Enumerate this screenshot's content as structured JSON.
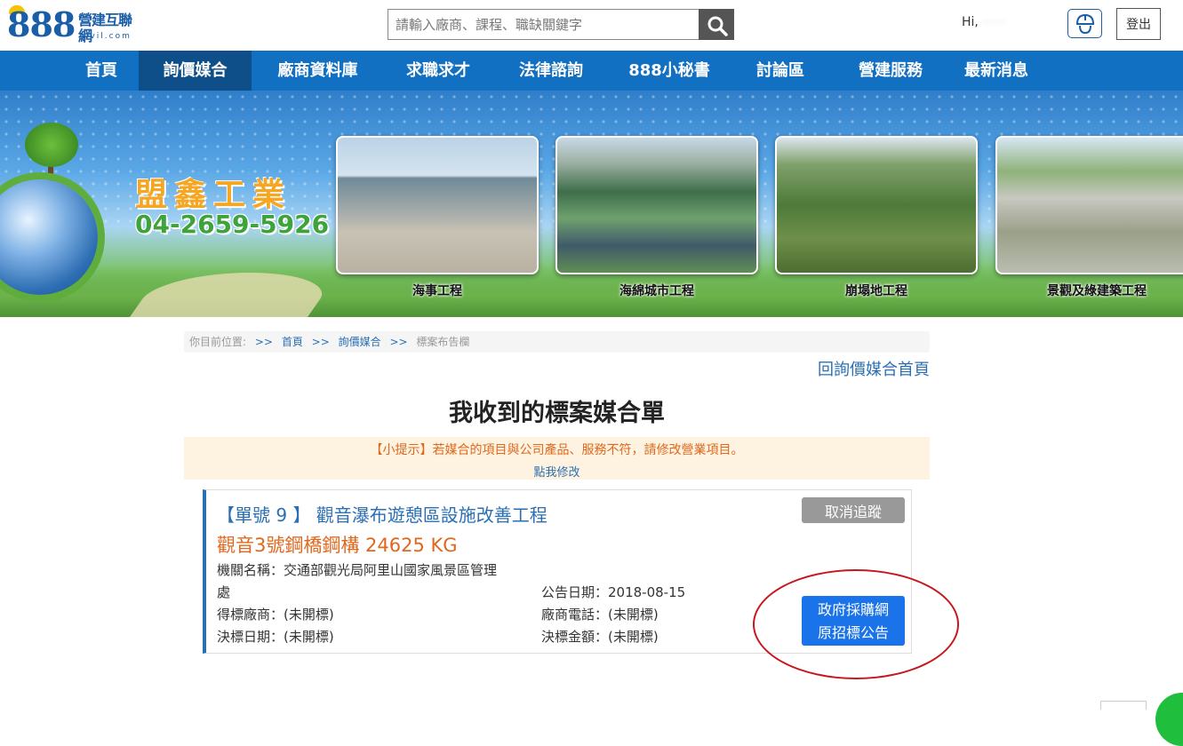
{
  "header": {
    "logo_number": "888",
    "logo_cn": "營建互聯網",
    "logo_domain": "civil.com",
    "search_placeholder": "請輸入廠商、課程、職缺關鍵字",
    "greeting": "Hi,",
    "logout_label": "登出"
  },
  "nav": {
    "items": [
      {
        "label": "首頁"
      },
      {
        "label": "詢價媒合"
      },
      {
        "label": "廠商資料庫"
      },
      {
        "label": "求職求才"
      },
      {
        "label": "法律諮詢"
      },
      {
        "label": "888小秘書"
      },
      {
        "label": "討論區"
      },
      {
        "label": "營建服務"
      },
      {
        "label": "最新消息"
      }
    ],
    "active_index": 1
  },
  "banner": {
    "company": "盟鑫工業",
    "phone": "04-2659-5926",
    "captions": [
      "海事工程",
      "海綿城市工程",
      "崩塌地工程",
      "景觀及綠建築工程"
    ]
  },
  "breadcrumb": {
    "prefix": "你目前位置:",
    "sep": ">>",
    "home": "首頁",
    "section": "詢價媒合",
    "current": "標案布告欄"
  },
  "back_link": "回詢價媒合首頁",
  "page_title": "我收到的標案媒合單",
  "tip": {
    "text": "【小提示】若媒合的項目與公司產品、服務不符，請修改營業項目。",
    "link": "點我修改"
  },
  "card": {
    "title": "【單號 9 】 觀音瀑布遊憩區設施改善工程",
    "cancel_label": "取消追蹤",
    "item": "觀音3號鋼橋鋼構 24625 KG",
    "agency_line1": "機關名稱：交通部觀光局阿里山國家風景區管理",
    "agency_line2": "處",
    "announce": "公告日期：2018-08-15",
    "winner": "得標廠商：(未開標)",
    "phone": "廠商電話：(未開標)",
    "decide_date": "決標日期：(未開標)",
    "decide_amount": "決標金額：(未開標)",
    "gov_btn_line1": "政府採購網",
    "gov_btn_line2": "原招標公告"
  },
  "colors": {
    "brand_blue": "#1170c2",
    "link_blue": "#2a6fb5",
    "orange": "#e0681e",
    "highlight_red": "#c8161d"
  }
}
